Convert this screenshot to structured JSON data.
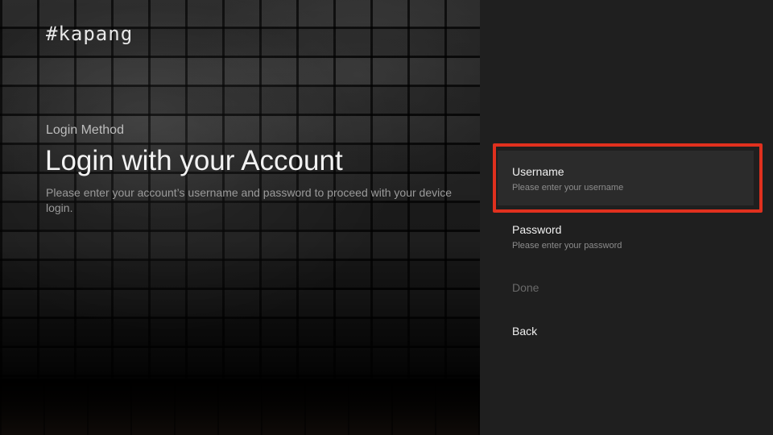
{
  "brand": {
    "logo_text": "#kapang"
  },
  "guidance": {
    "section_label": "Login Method",
    "title": "Login with your Account",
    "description": "Please enter your account’s username and password to proceed with your device login."
  },
  "menu": {
    "items": [
      {
        "label": "Username",
        "hint": "Please enter your username",
        "state": "focused"
      },
      {
        "label": "Password",
        "hint": "Please enter your password",
        "state": "normal"
      },
      {
        "label": "Done",
        "state": "disabled"
      },
      {
        "label": "Back",
        "state": "normal"
      }
    ]
  },
  "colors": {
    "focus_highlight": "#e0301e",
    "panel_background": "#1f1f1f",
    "focused_item_background": "#2b2b2b"
  }
}
